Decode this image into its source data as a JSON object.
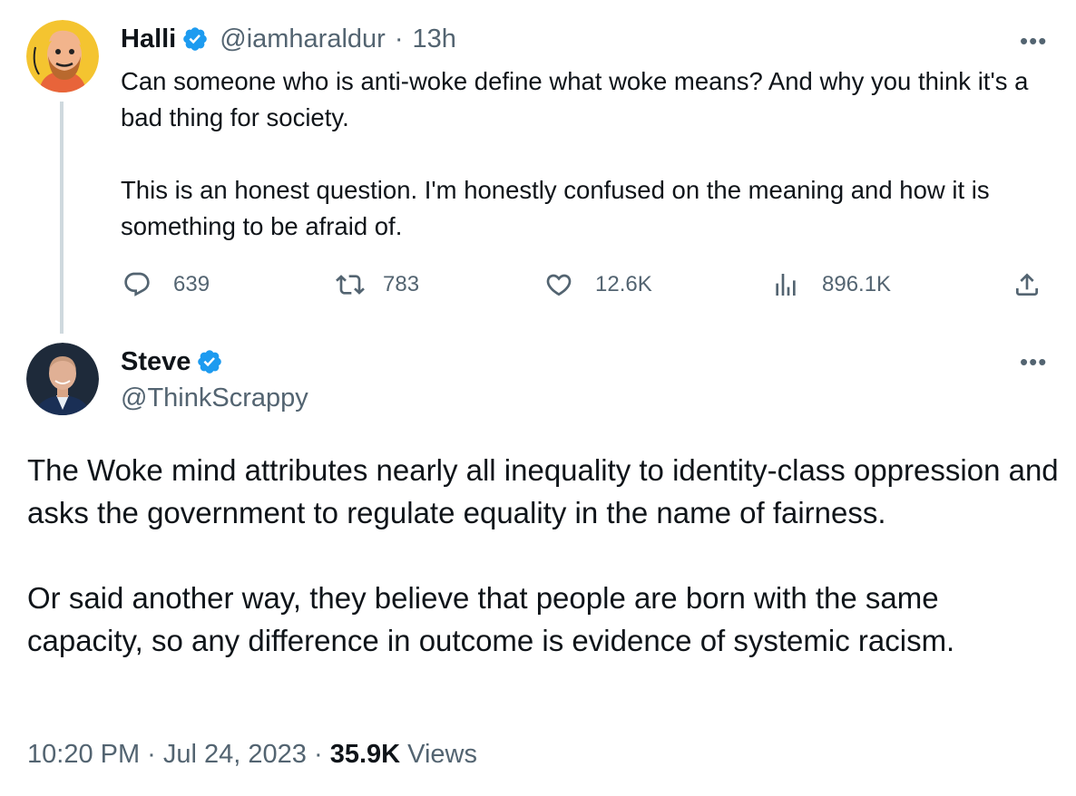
{
  "parent": {
    "name": "Halli",
    "handle": "@iamharaldur",
    "separator": "·",
    "time": "13h",
    "more": "•••",
    "text_p1": "Can someone who is anti-woke define what woke means? And why you think it's a bad thing for society.",
    "text_p2": "This is an honest question. I'm honestly confused on the meaning and how it is something to be afraid of.",
    "actions": {
      "replies": "639",
      "retweets": "783",
      "likes": "12.6K",
      "views": "896.1K"
    }
  },
  "main": {
    "name": "Steve",
    "handle": "@ThinkScrappy",
    "more": "•••",
    "text_p1": "The Woke mind attributes nearly all inequality to identity-class oppression and asks the government to regulate equality in the name of fairness.",
    "text_p2": "Or said another way, they believe that people are born with the same capacity, so any difference in outcome is evidence of systemic racism.",
    "timestamp": "10:20 PM · Jul 24, 2023",
    "dot": " · ",
    "views_count": "35.9K",
    "views_label": " Views"
  },
  "colors": {
    "text": "#0f1419",
    "secondary": "#536471",
    "verified": "#1d9bf0",
    "thread_line": "#cfd9de"
  },
  "icons": [
    "verified-badge-icon",
    "reply-icon",
    "retweet-icon",
    "like-icon",
    "views-icon",
    "share-icon",
    "more-icon"
  ]
}
